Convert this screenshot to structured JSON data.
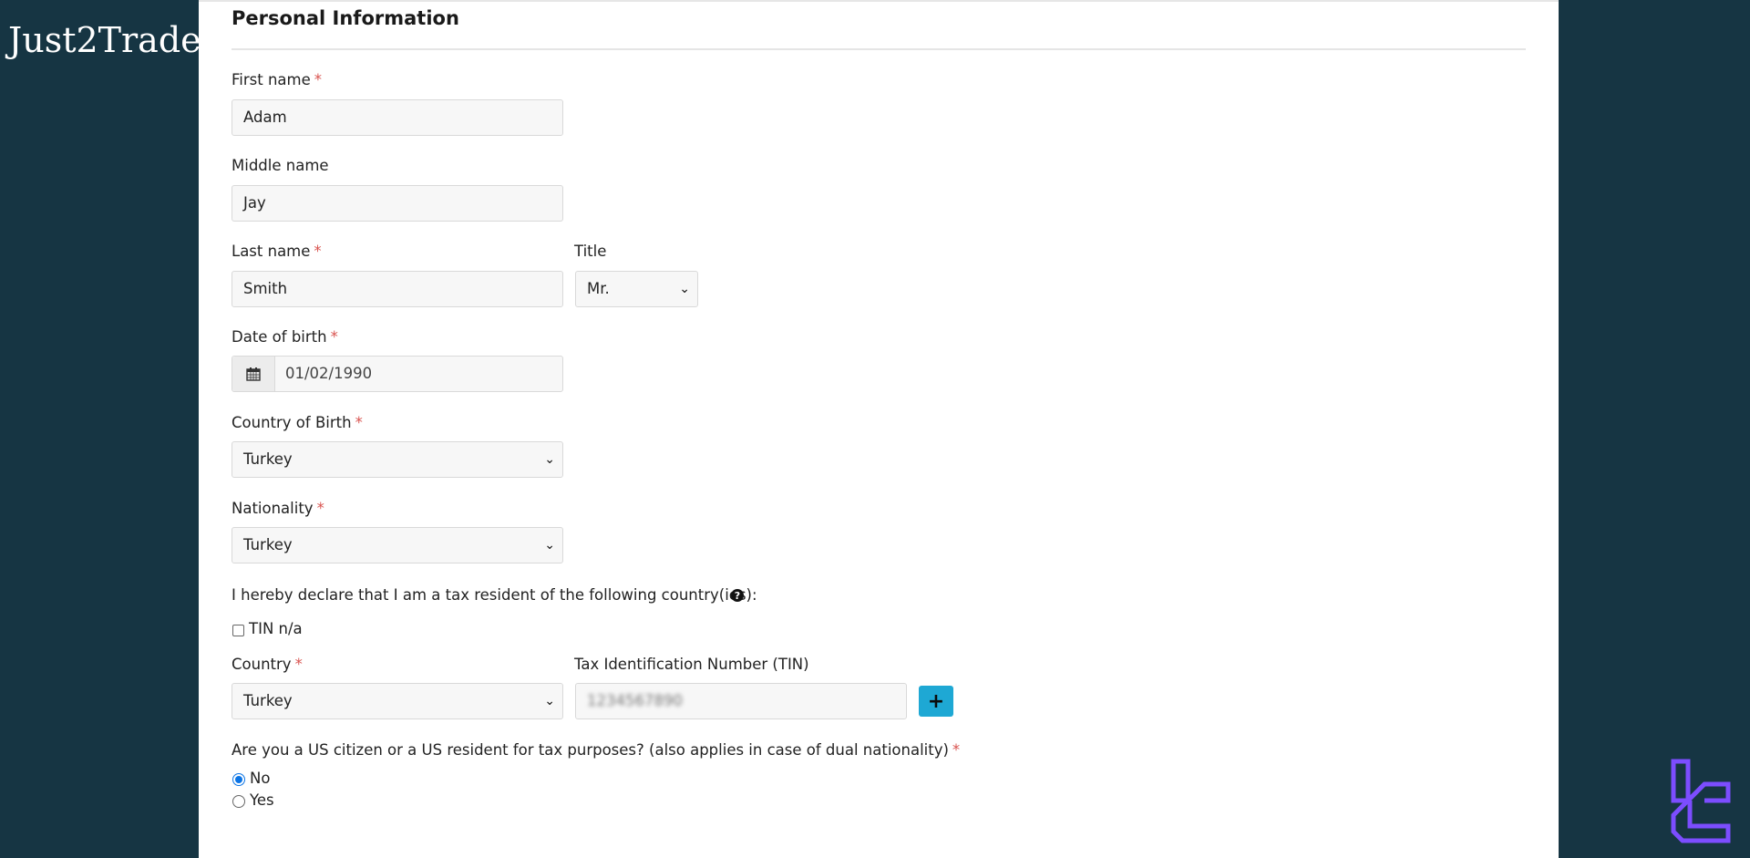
{
  "brand": {
    "name": "Just2Trade"
  },
  "section": {
    "title": "Personal Information"
  },
  "form": {
    "first_name": {
      "label": "First name",
      "required": "*",
      "value": "Adam"
    },
    "middle_name": {
      "label": "Middle name",
      "value": "Jay"
    },
    "last_name": {
      "label": "Last name",
      "required": "*",
      "value": "Smith"
    },
    "title": {
      "label": "Title",
      "value": "Mr."
    },
    "date_of_birth": {
      "label": "Date of birth",
      "required": "*",
      "value": "01/02/1990",
      "icon": "calendar-icon"
    },
    "country_of_birth": {
      "label": "Country of Birth",
      "required": "*",
      "value": "Turkey"
    },
    "nationality": {
      "label": "Nationality",
      "required": "*",
      "value": "Turkey"
    },
    "tax_declaration": {
      "text": "I hereby declare that I am a tax resident of the following country(ies):",
      "icon": "question-circle-icon"
    },
    "tin_na": {
      "label": "TIN n/a",
      "checked": false
    },
    "tax_country": {
      "label": "Country",
      "required": "*",
      "value": "Turkey"
    },
    "tin": {
      "label": "Tax Identification Number (TIN)",
      "value": "1234567890"
    },
    "add_button": {
      "label": "+",
      "icon": "plus-icon"
    },
    "us_person": {
      "question": "Are you a US citizen or a US resident for tax purposes? (also applies in case of dual nationality)",
      "required": "*",
      "options": [
        {
          "label": "No",
          "checked": true
        },
        {
          "label": "Yes",
          "checked": false
        }
      ]
    }
  },
  "colors": {
    "background": "#163543",
    "accent_button": "#1ea8d4",
    "required": "#d9534f",
    "radio_checked": "#0b74e5",
    "logo": "#7c4dff"
  }
}
